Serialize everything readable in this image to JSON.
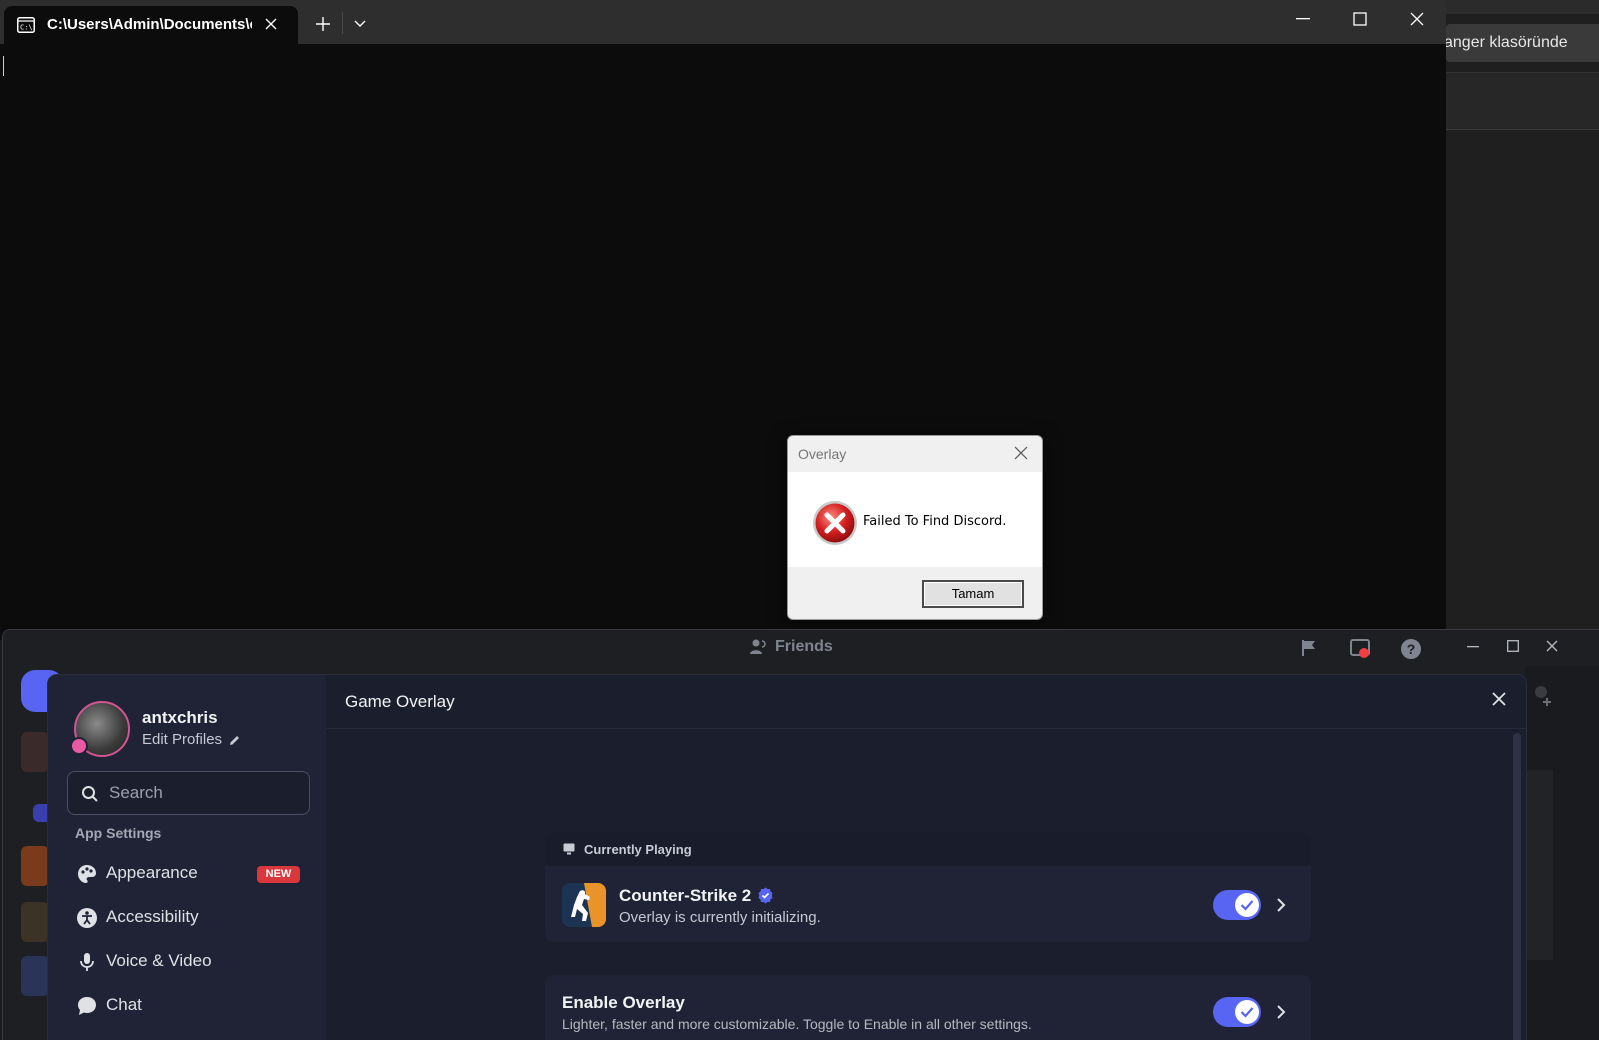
{
  "explorer": {
    "breadcrumb_text": "anger klasöründe"
  },
  "terminal": {
    "tab_title": "C:\\Users\\Admin\\Documents\\c",
    "new_tab_tooltip": "+",
    "icons": {
      "tab": "terminal-icon",
      "close": "close-icon",
      "new_tab": "plus-icon",
      "dropdown": "chevron-down-icon",
      "minimize": "minimize-icon",
      "maximize": "maximize-icon",
      "window_close": "close-icon"
    }
  },
  "message_box": {
    "title": "Overlay",
    "message": "Failed To Find Discord.",
    "ok_label": "Tamam",
    "icon": "error-icon"
  },
  "discord": {
    "window_title": "Friends",
    "user": {
      "username": "antxchris",
      "edit_profiles_label": "Edit Profiles"
    },
    "search": {
      "placeholder": "Search"
    },
    "sidebar": {
      "section_label": "App Settings",
      "items": [
        {
          "label": "Appearance",
          "badge": "NEW",
          "icon": "palette-icon"
        },
        {
          "label": "Accessibility",
          "icon": "accessibility-icon"
        },
        {
          "label": "Voice & Video",
          "icon": "microphone-icon"
        },
        {
          "label": "Chat",
          "icon": "chat-bubble-icon"
        }
      ]
    },
    "main": {
      "heading": "Game Overlay",
      "currently_playing": {
        "header": "Currently Playing",
        "game_name": "Counter-Strike 2",
        "status": "Overlay is currently initializing.",
        "overlay_enabled": true
      },
      "enable_overlay": {
        "title": "Enable Overlay",
        "description": "Lighter, faster and more customizable. Toggle to Enable in all other settings.",
        "enabled": true
      }
    },
    "colors": {
      "accent": "#5865f2",
      "new_badge": "#da373c"
    }
  }
}
